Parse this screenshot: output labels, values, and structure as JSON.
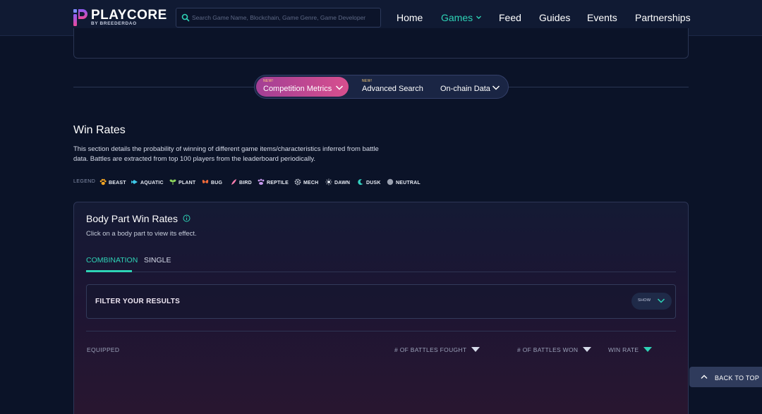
{
  "header": {
    "brand": "PLAYCORE",
    "brand_sub": "BY BREEDERDAO",
    "search_placeholder": "Search Game Name, Blockchain, Game Genre, Game Developer",
    "search_value": "",
    "nav": [
      {
        "label": "Home",
        "active": false
      },
      {
        "label": "Games",
        "active": true,
        "has_dropdown": true
      },
      {
        "label": "Feed",
        "active": false
      },
      {
        "label": "Guides",
        "active": false
      },
      {
        "label": "Events",
        "active": false
      },
      {
        "label": "Partnerships",
        "active": false
      }
    ],
    "accent_color": "#2ed3b6"
  },
  "switcher": {
    "items": [
      {
        "label": "Competition Metrics",
        "badge": "NEW!",
        "active": true,
        "has_dropdown": true
      },
      {
        "label": "Advanced Search",
        "badge": "NEW!",
        "active": false,
        "has_dropdown": false
      },
      {
        "label": "On-chain Data",
        "badge": "",
        "active": false,
        "has_dropdown": true
      }
    ]
  },
  "win_rates": {
    "title": "Win Rates",
    "description": "This section details the probability of winning of different game items/characteristics inferred from battle data. Battles are extracted from top 100 players from the leaderboard periodically.",
    "legend_title": "LEGEND",
    "legend": [
      {
        "label": "BEAST",
        "icon": "paw-icon",
        "color": "#f5a623"
      },
      {
        "label": "AQUATIC",
        "icon": "fish-icon",
        "color": "#3ec8e8"
      },
      {
        "label": "PLANT",
        "icon": "leaf-icon",
        "color": "#8bd35b"
      },
      {
        "label": "BUG",
        "icon": "butterfly-icon",
        "color": "#f06a3a"
      },
      {
        "label": "BIRD",
        "icon": "feather-icon",
        "color": "#ff7eb0"
      },
      {
        "label": "REPTILE",
        "icon": "claw-icon",
        "color": "#c99bf0"
      },
      {
        "label": "MECH",
        "icon": "gear-icon",
        "color": "#c7ccd6"
      },
      {
        "label": "DAWN",
        "icon": "sun-icon",
        "color": "#d9dde6"
      },
      {
        "label": "DUSK",
        "icon": "moon-icon",
        "color": "#34d0c0"
      },
      {
        "label": "NEUTRAL",
        "icon": "circle-icon",
        "color": "#9aa1b0"
      }
    ]
  },
  "body_parts": {
    "title": "Body Part Win Rates",
    "subtitle": "Click on a body part to view its effect.",
    "tabs": [
      {
        "label": "COMBINATION",
        "active": true
      },
      {
        "label": "SINGLE",
        "active": false
      }
    ],
    "filter": {
      "title": "FILTER YOUR RESULTS",
      "toggle_label": "SHOW"
    },
    "columns": [
      {
        "label": "EQUIPPED",
        "sortable": false
      },
      {
        "label": "# OF BATTLES FOUGHT",
        "sortable": true,
        "sort_color": "#d7dcea"
      },
      {
        "label": "# OF BATTLES WON",
        "sortable": true,
        "sort_color": "#d7dcea"
      },
      {
        "label": "WIN RATE",
        "sortable": true,
        "sort_color": "#2ed3b6"
      }
    ]
  },
  "back_to_top": {
    "label": "BACK TO TOP"
  }
}
